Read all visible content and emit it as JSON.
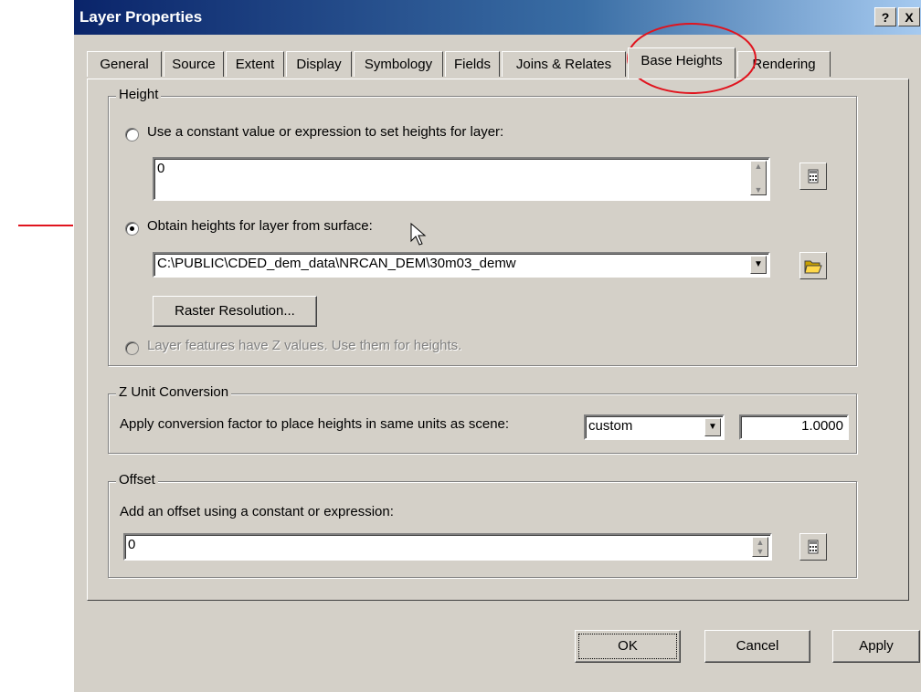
{
  "window": {
    "title": "Layer Properties",
    "help_label": "?",
    "close_label": "X"
  },
  "tabs": [
    {
      "label": "General"
    },
    {
      "label": "Source"
    },
    {
      "label": "Extent"
    },
    {
      "label": "Display"
    },
    {
      "label": "Symbology"
    },
    {
      "label": "Fields"
    },
    {
      "label": "Joins & Relates"
    },
    {
      "label": "Base Heights",
      "active": true
    },
    {
      "label": "Rendering"
    }
  ],
  "height": {
    "legend": "Height",
    "constant_label": "Use a constant value or expression to set heights for layer:",
    "constant_value": "0",
    "surface_label": "Obtain heights for layer from surface:",
    "surface_path": "C:\\PUBLIC\\CDED_dem_data\\NRCAN_DEM\\30m03_demw",
    "raster_button": "Raster Resolution...",
    "z_values_label": "Layer features have Z values.  Use them for heights."
  },
  "z_unit": {
    "legend": "Z Unit Conversion",
    "label": "Apply conversion factor to place heights in same units as scene:",
    "unit_value": "custom",
    "factor_value": "1.0000"
  },
  "offset": {
    "legend": "Offset",
    "label": "Add an offset using a constant or expression:",
    "value": "0"
  },
  "buttons": {
    "ok": "OK",
    "cancel": "Cancel",
    "apply": "Apply"
  },
  "colors": {
    "annotation_red": "#e0141e",
    "title_blue": "#0a246a"
  }
}
